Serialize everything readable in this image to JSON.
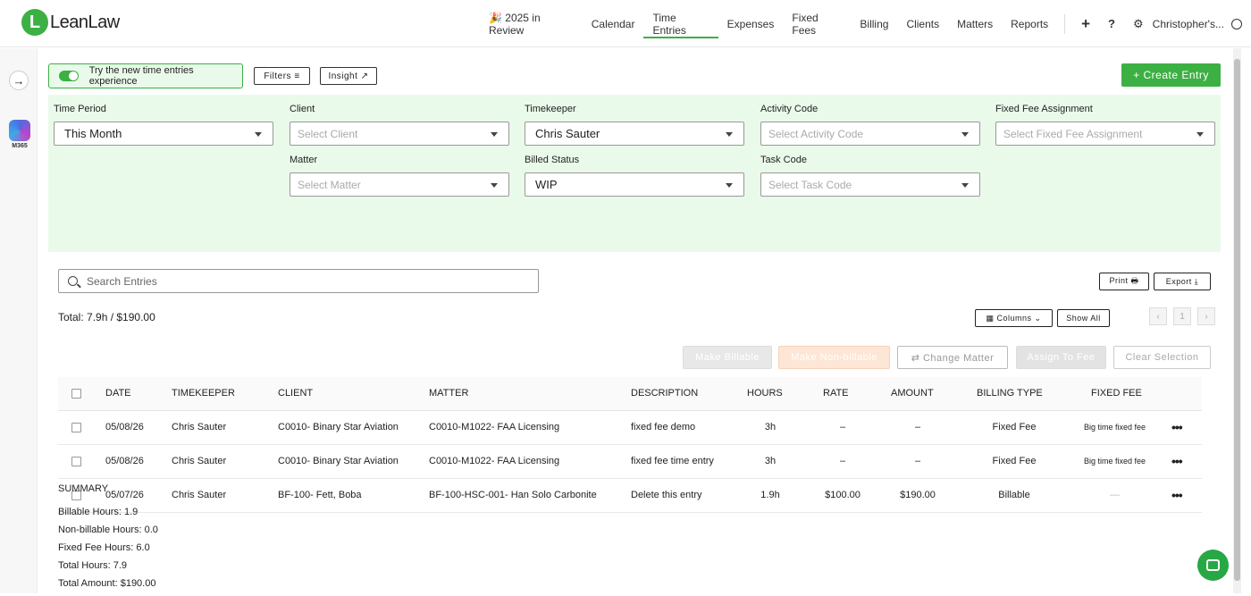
{
  "brand": {
    "logo_letter": "L",
    "name": "LeanLaw"
  },
  "nav": {
    "items": [
      {
        "label": "🎉 2025 in Review"
      },
      {
        "label": "Calendar"
      },
      {
        "label": "Time Entries",
        "active": true
      },
      {
        "label": "Expenses"
      },
      {
        "label": "Fixed Fees"
      },
      {
        "label": "Billing"
      },
      {
        "label": "Clients"
      },
      {
        "label": "Matters"
      },
      {
        "label": "Reports"
      }
    ],
    "plus_glyph": "+",
    "help_glyph": "?",
    "settings_glyph": "⚙",
    "user_label": "Christopher's..."
  },
  "sidebar": {
    "expand_glyph": "→",
    "m365_label": "M365"
  },
  "toolbar": {
    "toggle_label": "Try the new time entries experience",
    "filters_label": "Filters ≡",
    "insight_label": "Insight ↗",
    "create_label": "+  Create Entry"
  },
  "filters": {
    "time_period": {
      "label": "Time Period",
      "value": "This Month"
    },
    "client": {
      "label": "Client",
      "placeholder": "Select Client"
    },
    "timekeeper": {
      "label": "Timekeeper",
      "value": "Chris Sauter"
    },
    "activity_code": {
      "label": "Activity Code",
      "placeholder": "Select Activity Code"
    },
    "fixed_fee": {
      "label": "Fixed Fee Assignment",
      "placeholder": "Select Fixed Fee Assignment"
    },
    "matter": {
      "label": "Matter",
      "placeholder": "Select Matter"
    },
    "billed_status": {
      "label": "Billed Status",
      "value": "WIP"
    },
    "task_code": {
      "label": "Task Code",
      "placeholder": "Select Task Code"
    }
  },
  "content": {
    "search_placeholder": "Search Entries",
    "print_label": "Print 🖶",
    "export_label": "Export ⤓",
    "total_text": "Total:   7.9h /   $190.00",
    "columns_label": "▦  Columns  ⌄",
    "show_all_label": "Show All",
    "pager_prev": "‹",
    "pager_page": "1",
    "pager_next": "›",
    "bulk": {
      "make_billable": "Make Billable",
      "make_nonbillable": "Make Non-billable",
      "change_matter": "⇄  Change Matter",
      "assign_fee": "Assign To Fee",
      "clear_selection": "Clear Selection"
    }
  },
  "table": {
    "headers": {
      "date": "DATE",
      "timekeeper": "TIMEKEEPER",
      "client": "CLIENT",
      "matter": "MATTER",
      "description": "DESCRIPTION",
      "hours": "HOURS",
      "rate": "RATE",
      "amount": "AMOUNT",
      "billing_type": "BILLING TYPE",
      "fixed_fee": "FIXED FEE"
    },
    "rows": [
      {
        "date": "05/08/26",
        "timekeeper": "Chris Sauter",
        "client": "C0010- Binary Star Aviation",
        "matter": "C0010-M1022- FAA Licensing",
        "description": "fixed fee demo",
        "hours": "3h",
        "rate": "–",
        "amount": "–",
        "billing_type": "Fixed Fee",
        "fixed_fee": "Big time fixed fee",
        "more": "•••"
      },
      {
        "date": "05/08/26",
        "timekeeper": "Chris Sauter",
        "client": "C0010- Binary Star Aviation",
        "matter": "C0010-M1022- FAA Licensing",
        "description": "fixed fee time entry",
        "hours": "3h",
        "rate": "–",
        "amount": "–",
        "billing_type": "Fixed Fee",
        "fixed_fee": "Big time fixed fee",
        "more": "•••"
      },
      {
        "date": "05/07/26",
        "timekeeper": "Chris Sauter",
        "client": "BF-100- Fett, Boba",
        "matter": "BF-100-HSC-001- Han Solo Carbonite",
        "description": "Delete this entry",
        "hours": "1.9h",
        "rate": "$100.00",
        "amount": "$190.00",
        "billing_type": "Billable",
        "fixed_fee": "—",
        "more": "•••"
      }
    ]
  },
  "summary": {
    "title": "SUMMARY",
    "billable": "Billable Hours:   1.9",
    "nonbillable": "Non-billable Hours:   0.0",
    "fixed_fee": "Fixed Fee Hours:   6.0",
    "total_hours": "Total Hours:   7.9",
    "total_amount": "Total Amount:   $190.00"
  },
  "colors": {
    "accent": "#3cb043",
    "panel_bg": "#eafaea"
  }
}
